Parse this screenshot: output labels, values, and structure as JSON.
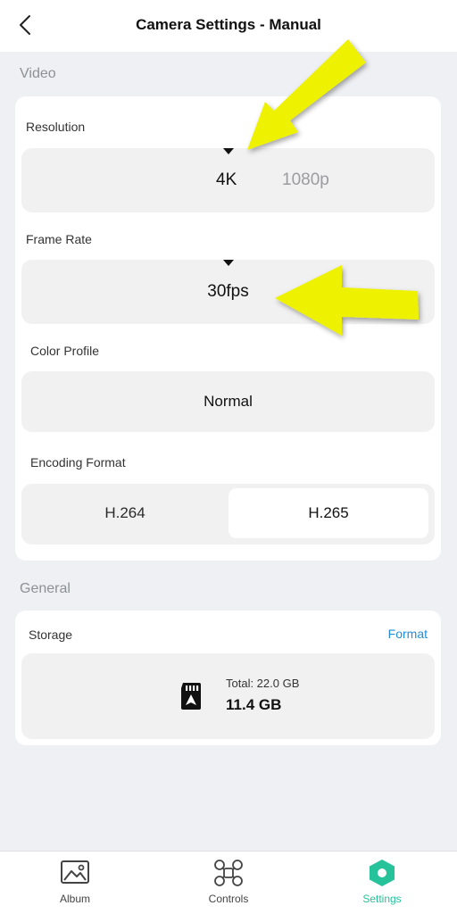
{
  "header": {
    "title": "Camera Settings - Manual"
  },
  "sections": {
    "video": "Video",
    "general": "General"
  },
  "video": {
    "resolution": {
      "label": "Resolution",
      "selected": "4K",
      "other": "1080p"
    },
    "frame_rate": {
      "label": "Frame Rate",
      "selected": "30fps"
    },
    "color_profile": {
      "label": "Color Profile",
      "selected": "Normal"
    },
    "encoding": {
      "label": "Encoding Format",
      "options": [
        "H.264",
        "H.265"
      ],
      "selected": "H.265"
    }
  },
  "general": {
    "storage": {
      "label": "Storage",
      "format_label": "Format",
      "total": "Total: 22.0 GB",
      "free": "11.4 GB"
    }
  },
  "nav": {
    "album": "Album",
    "controls": "Controls",
    "settings": "Settings",
    "active": "Settings"
  },
  "colors": {
    "accent": "#26c29a",
    "link": "#1f8ed6",
    "annotation_arrow": "#eef200"
  }
}
